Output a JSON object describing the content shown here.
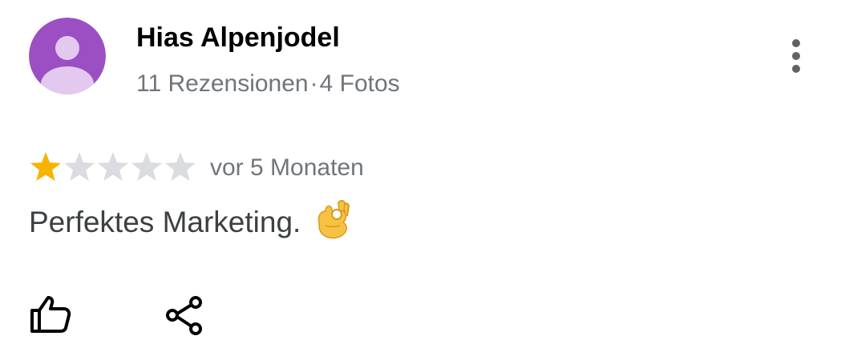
{
  "reviewer": {
    "name": "Hias Alpenjodel",
    "reviews_count": "11 Rezensionen",
    "separator": "·",
    "photos_count": "4 Fotos",
    "avatar_color": "#9c4fc2",
    "avatar_figure_color": "#e3c9ef"
  },
  "review": {
    "rating": 1,
    "max_rating": 5,
    "star_filled_color": "#f4b400",
    "star_empty_color": "#dadce0",
    "time_ago": "vor 5 Monaten",
    "text": "Perfektes Marketing.",
    "emoji": "ok-hand-emoji"
  },
  "actions": {
    "like_icon": "thumbs-up-icon",
    "share_icon": "share-icon",
    "more_icon": "more-vertical-icon"
  }
}
